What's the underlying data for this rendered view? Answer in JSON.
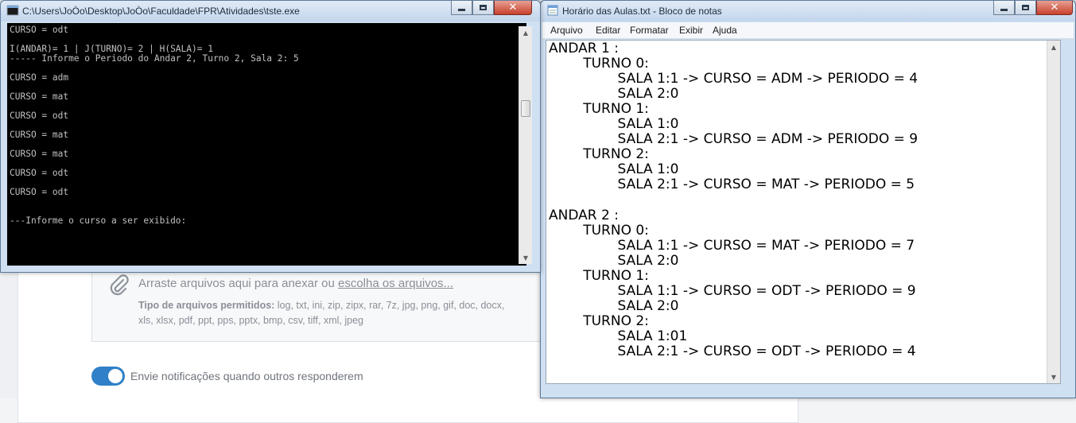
{
  "background": {
    "dropzone": {
      "text": "Arraste arquivos aqui para anexar ou ",
      "link": "escolha os arquivos...",
      "types_label": "Tipo de arquivos permitidos:",
      "types_line1": " log, txt, ini, zip, zipx, rar, 7z, jpg, png, gif, doc, docx,",
      "types_line2": "xls, xlsx, pdf, ppt, pps, pptx, bmp, csv, tiff, xml, jpeg"
    },
    "notify_toggle": {
      "label": "Envie notificações quando outros responderem",
      "on": true
    }
  },
  "console": {
    "title": "C:\\Users\\JoÒo\\Desktop\\JoÒo\\Faculdade\\FPR\\Atividades\\tste.exe",
    "lines": [
      "CURSO = odt",
      "I(ANDAR)= 1 | J(TURNO)= 2 | H(SALA)= 1",
      "----- Informe o Periodo do Andar 2, Turno 2, Sala 2: 5",
      "CURSO = adm",
      "CURSO = mat",
      "CURSO = odt",
      "CURSO = mat",
      "CURSO = mat",
      "CURSO = odt",
      "CURSO = odt",
      "---Informe o curso a ser exibido:"
    ]
  },
  "notepad": {
    "title": "Horário das Aulas.txt - Bloco de notas",
    "menu": [
      "Arquivo",
      "Editar",
      "Formatar",
      "Exibir",
      "Ajuda"
    ],
    "lines": [
      "ANDAR 1 :",
      "        TURNO 0:",
      "                SALA 1:1 -> CURSO = ADM -> PERIODO = 4",
      "                SALA 2:0",
      "        TURNO 1:",
      "                SALA 1:0",
      "                SALA 2:1 -> CURSO = ADM -> PERIODO = 9",
      "        TURNO 2:",
      "                SALA 1:0",
      "                SALA 2:1 -> CURSO = MAT -> PERIODO = 5",
      "",
      "ANDAR 2 :",
      "        TURNO 0:",
      "                SALA 1:1 -> CURSO = MAT -> PERIODO = 7",
      "                SALA 2:0",
      "        TURNO 1:",
      "                SALA 1:1 -> CURSO = ODT -> PERIODO = 9",
      "                SALA 2:0",
      "        TURNO 2:",
      "                SALA 1:01",
      "                SALA 2:1 -> CURSO = ODT -> PERIODO = 4"
    ]
  },
  "window_buttons": {
    "minimize": "minimize",
    "maximize": "maximize",
    "close": "✕"
  }
}
